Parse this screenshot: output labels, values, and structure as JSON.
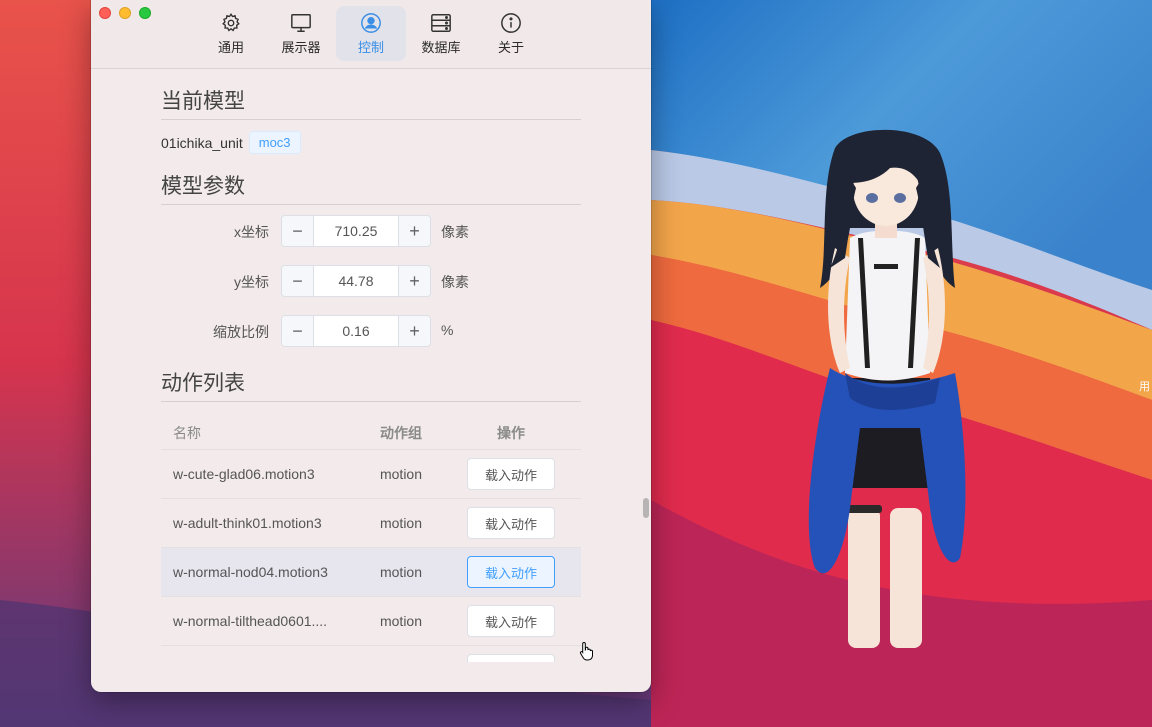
{
  "tabs": [
    {
      "label": "通用",
      "icon": "gear-icon"
    },
    {
      "label": "展示器",
      "icon": "monitor-icon"
    },
    {
      "label": "控制",
      "icon": "user-circle-icon"
    },
    {
      "label": "数据库",
      "icon": "database-icon"
    },
    {
      "label": "关于",
      "icon": "info-icon"
    }
  ],
  "active_tab": "控制",
  "current_model": {
    "title": "当前模型",
    "name": "01ichika_unit",
    "tag": "moc3"
  },
  "params": {
    "title": "模型参数",
    "rows": [
      {
        "label": "x坐标",
        "value": "710.25",
        "unit": "像素"
      },
      {
        "label": "y坐标",
        "value": "44.78",
        "unit": "像素"
      },
      {
        "label": "缩放比例",
        "value": "0.16",
        "unit": "%"
      }
    ],
    "dec": "−",
    "inc": "+"
  },
  "motions": {
    "title": "动作列表",
    "headers": {
      "name": "名称",
      "group": "动作组",
      "op": "操作"
    },
    "rows": [
      {
        "name": "w-cute-glad06.motion3",
        "group": "motion",
        "action": "载入动作"
      },
      {
        "name": "w-adult-think01.motion3",
        "group": "motion",
        "action": "载入动作"
      },
      {
        "name": "w-normal-nod04.motion3",
        "group": "motion",
        "action": "载入动作"
      },
      {
        "name": "w-normal-tilthead0601....",
        "group": "motion",
        "action": "载入动作"
      }
    ]
  },
  "desktop_side_text": "用",
  "colors": {
    "accent": "#409eff",
    "window_bg": "#f3ebeb"
  }
}
